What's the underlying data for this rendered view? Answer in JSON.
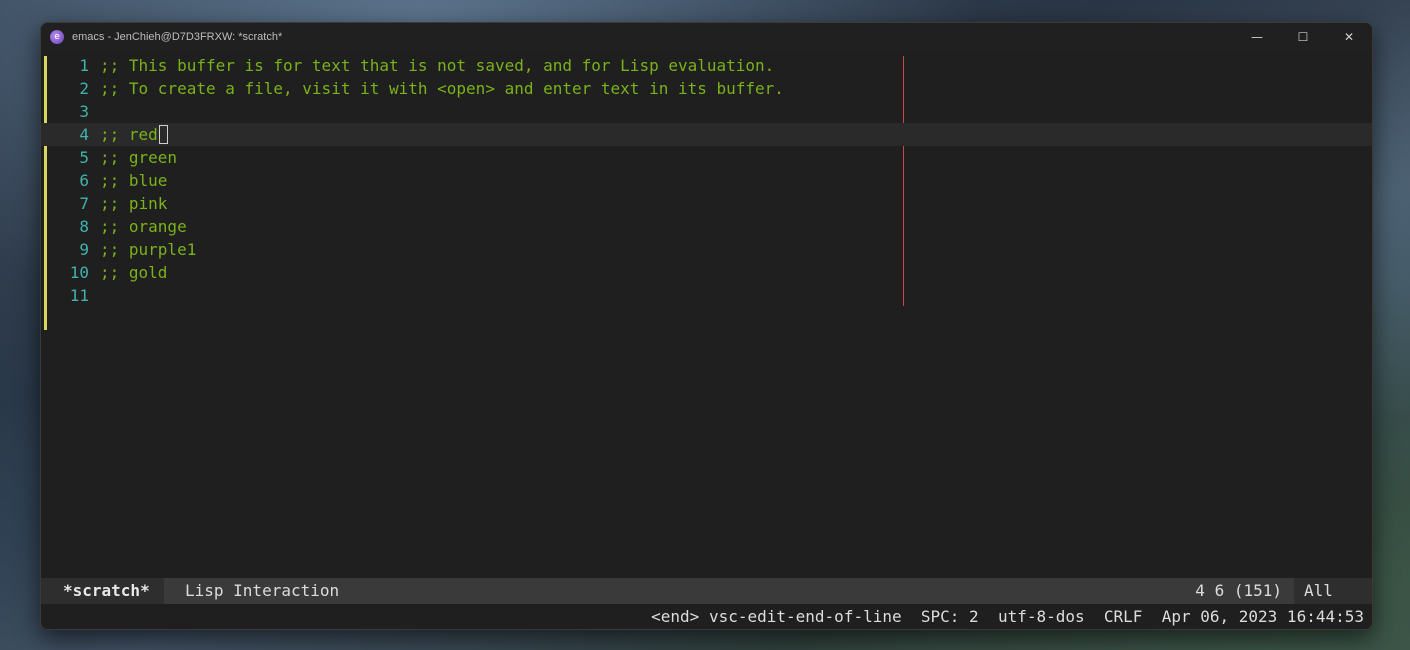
{
  "window": {
    "title": "emacs - JenChieh@D7D3FRXW: *scratch*",
    "controls": {
      "minimize": "—",
      "maximize": "☐",
      "close": "✕"
    }
  },
  "editor": {
    "lines": [
      {
        "number": "1",
        "text": ";; This buffer is for text that is not saved, and for Lisp evaluation."
      },
      {
        "number": "2",
        "text": ";; To create a file, visit it with <open> and enter text in its buffer."
      },
      {
        "number": "3",
        "text": ""
      },
      {
        "number": "4",
        "text": ";; red"
      },
      {
        "number": "5",
        "text": ";; green"
      },
      {
        "number": "6",
        "text": ";; blue"
      },
      {
        "number": "7",
        "text": ";; pink"
      },
      {
        "number": "8",
        "text": ";; orange"
      },
      {
        "number": "9",
        "text": ";; purple1"
      },
      {
        "number": "10",
        "text": ";; gold"
      },
      {
        "number": "11",
        "text": ""
      }
    ],
    "current_line": 4,
    "colors": {
      "comment": "#7ab21a",
      "line_number": "#3fb3ac",
      "fill_column": "#c24a4a"
    }
  },
  "modeline": {
    "buffer_name": "*scratch*",
    "major_mode": "Lisp Interaction",
    "position": "4 6 (151)",
    "scroll": "All"
  },
  "minibuffer": {
    "keybinding": "<end>",
    "command": "vsc-edit-end-of-line",
    "indent": "SPC: 2",
    "encoding": "utf-8-dos",
    "eol": "CRLF",
    "datetime": "Apr 06, 2023 16:44:53"
  }
}
